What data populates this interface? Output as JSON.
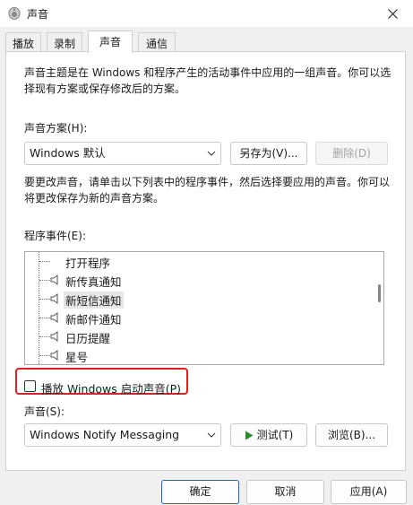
{
  "window": {
    "title": "声音",
    "icon": "speaker-app-icon",
    "close_icon": "close-icon"
  },
  "tabs": [
    {
      "label": "播放"
    },
    {
      "label": "录制"
    },
    {
      "label": "声音",
      "active": true
    },
    {
      "label": "通信"
    }
  ],
  "intro_text": "声音主题是在 Windows 和程序产生的活动事件中应用的一组声音。你可以选择现有方案或保存修改后的方案。",
  "scheme": {
    "label": "声音方案(H):",
    "selected": "Windows 默认",
    "save_as_label": "另存为(V)...",
    "delete_label": "删除(D)"
  },
  "change_text": "要更改声音，请单击以下列表中的程序事件，然后选择要应用的声音。你可以将更改保存为新的声音方案。",
  "events": {
    "label": "程序事件(E):",
    "items": [
      {
        "label": "打开程序",
        "has_sound": false
      },
      {
        "label": "新传真通知",
        "has_sound": true
      },
      {
        "label": "新短信通知",
        "has_sound": true,
        "selected": true
      },
      {
        "label": "新邮件通知",
        "has_sound": true
      },
      {
        "label": "日历提醒",
        "has_sound": true
      },
      {
        "label": "星号",
        "has_sound": true
      }
    ]
  },
  "startup_checkbox": {
    "label": "播放 Windows 启动声音(P)",
    "checked": false
  },
  "sound": {
    "label": "声音(S):",
    "selected": "Windows Notify Messaging",
    "test_label": "测试(T)",
    "browse_label": "浏览(B)..."
  },
  "footer": {
    "ok_label": "确定",
    "cancel_label": "取消",
    "apply_label": "应用(A)"
  },
  "colors": {
    "highlight": "#e02020",
    "primary_border": "#1a66c9",
    "play_icon": "#2a8a2a"
  }
}
